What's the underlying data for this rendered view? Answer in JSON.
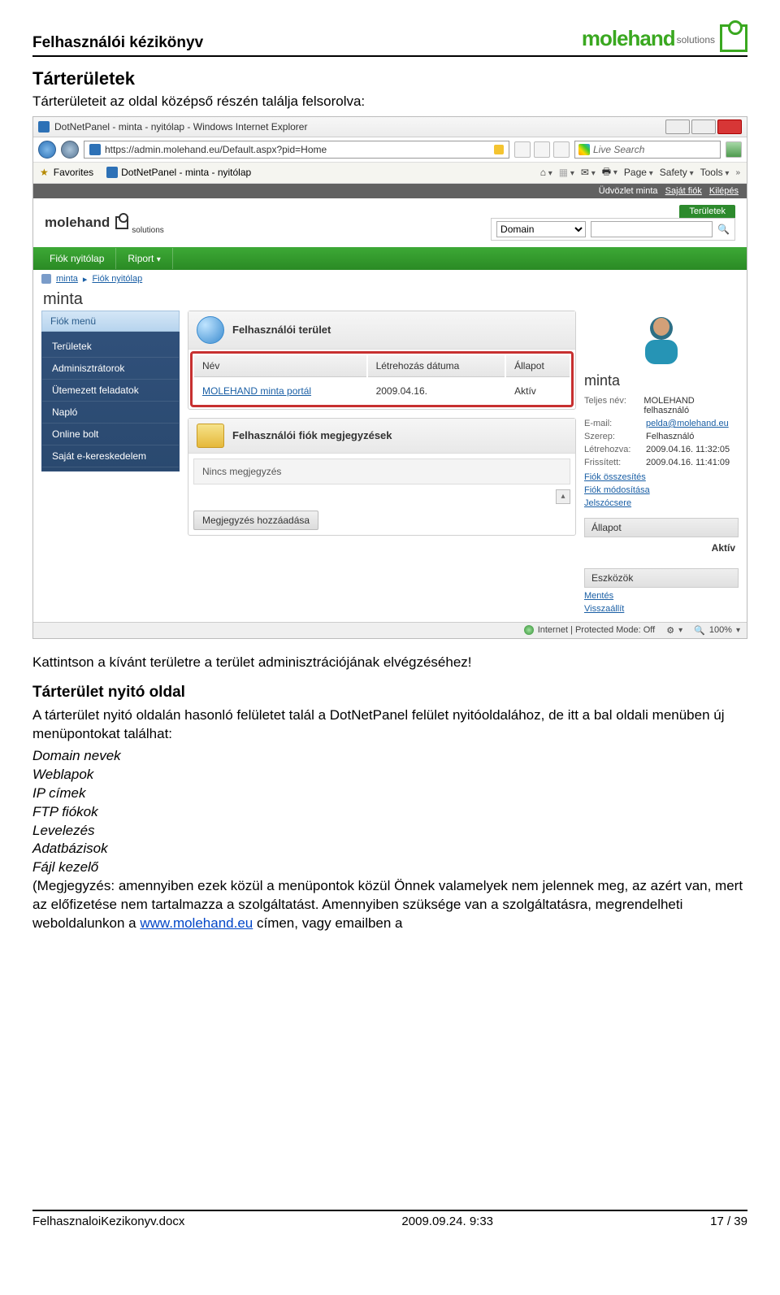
{
  "doc": {
    "header_title": "Felhasználói kézikönyv",
    "logo1": "molehand",
    "logo2": "solutions"
  },
  "section1": {
    "title": "Tárterületek",
    "intro": "Tárterületeit az oldal középső részén találja felsorolva:"
  },
  "shot": {
    "ie_title": "DotNetPanel - minta - nyitólap - Windows Internet Explorer",
    "url": "https://admin.molehand.eu/Default.aspx?pid=Home",
    "search_ph": "Live Search",
    "fav_label": "Favorites",
    "tab_label": "DotNetPanel - minta - nyitólap",
    "cmd_page": "Page",
    "cmd_safety": "Safety",
    "cmd_tools": "Tools",
    "welcome": "Üdvözlet minta",
    "welcome_l1": "Saját fiók",
    "welcome_l2": "Kilépés",
    "sa_label": "Területek",
    "sa_select": "Domain",
    "greentabs": [
      "Fiók nyitólap",
      "Riport"
    ],
    "crumb1": "minta",
    "crumb2": "Fiók nyitólap",
    "acct": "minta",
    "side_header": "Fiók menü",
    "side_items": [
      "Területek",
      "Adminisztrátorok",
      "Ütemezett feladatok",
      "Napló",
      "Online bolt",
      "Saját e-kereskedelem"
    ],
    "card1_title": "Felhasználói terület",
    "tbl": {
      "h1": "Név",
      "h2": "Létrehozás dátuma",
      "h3": "Állapot",
      "r1c1": "MOLEHAND minta portál",
      "r1c2": "2009.04.16.",
      "r1c3": "Aktív"
    },
    "card2_title": "Felhasználói fiók megjegyzések",
    "no_note": "Nincs megjegyzés",
    "add_note": "Megjegyzés hozzáadása",
    "r_name": "minta",
    "r_rows": [
      {
        "k": "Teljes név:",
        "v": "MOLEHAND felhasználó"
      },
      {
        "k": "E-mail:",
        "v": "pelda@molehand.eu"
      },
      {
        "k": "Szerep:",
        "v": "Felhasználó"
      },
      {
        "k": "Létrehozva:",
        "v": "2009.04.16. 11:32:05"
      },
      {
        "k": "Frissített:",
        "v": "2009.04.16. 11:41:09"
      }
    ],
    "r_links": [
      "Fiók összesítés",
      "Fiók módosítása",
      "Jelszócsere"
    ],
    "r_sec_status": "Állapot",
    "r_status_val": "Aktív",
    "r_sec_tools": "Eszközök",
    "r_tool_links": [
      "Mentés",
      "Visszaállít"
    ],
    "status_zone": "Internet | Protected Mode: Off",
    "status_zoom": "100%"
  },
  "after": {
    "p1": "Kattintson a kívánt területre a terület adminisztrációjának elvégzéséhez!",
    "h2": "Tárterület nyitó oldal",
    "p2": "A tárterület nyitó oldalán hasonló felületet talál a DotNetPanel felület nyitóoldalához, de itt a bal oldali menüben új menüpontokat találhat:",
    "items": [
      "Domain nevek",
      "Weblapok",
      "IP címek",
      "FTP fiókok",
      "Levelezés",
      "Adatbázisok",
      "Fájl kezelő"
    ],
    "p3a": "(Megjegyzés: amennyiben ezek közül a menüpontok közül Önnek valamelyek nem jelennek meg, az azért van, mert az előfizetése nem tartalmazza a szolgáltatást. Amennyiben szüksége van a szolgáltatásra, megrendelheti weboldalunkon a ",
    "p3link": "www.molehand.eu",
    "p3b": " címen, vagy emailben a"
  },
  "footer": {
    "left": "FelhasznaloiKezikonyv.docx",
    "center": "2009.09.24. 9:33",
    "right": "17 / 39"
  }
}
